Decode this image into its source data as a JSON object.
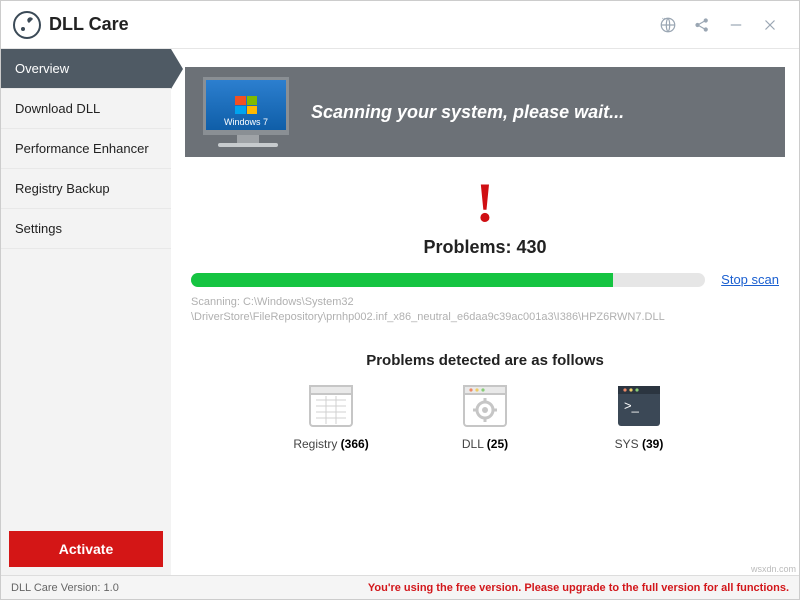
{
  "app": {
    "title": "DLL Care"
  },
  "sidebar": {
    "items": [
      {
        "label": "Overview",
        "active": true
      },
      {
        "label": "Download DLL"
      },
      {
        "label": "Performance Enhancer"
      },
      {
        "label": "Registry Backup"
      },
      {
        "label": "Settings"
      }
    ],
    "activate_label": "Activate"
  },
  "banner": {
    "os_label": "Windows 7",
    "text": "Scanning your system, please wait..."
  },
  "scan": {
    "problems_label": "Problems: 430",
    "progress_pct": 82,
    "stop_label": "Stop scan",
    "path_line1": "Scanning: C:\\Windows\\System32",
    "path_line2": "\\DriverStore\\FileRepository\\prnhp002.inf_x86_neutral_e6daa9c39ac001a3\\I386\\HPZ6RWN7.DLL"
  },
  "detected": {
    "title": "Problems detected are as follows",
    "categories": [
      {
        "name": "Registry",
        "count": "(366)"
      },
      {
        "name": "DLL",
        "count": "(25)"
      },
      {
        "name": "SYS",
        "count": "(39)"
      }
    ]
  },
  "footer": {
    "version": "DLL Care Version: 1.0",
    "upgrade": "You're using the free version. Please upgrade to the full version for all functions."
  },
  "watermark": "wsxdn.com"
}
